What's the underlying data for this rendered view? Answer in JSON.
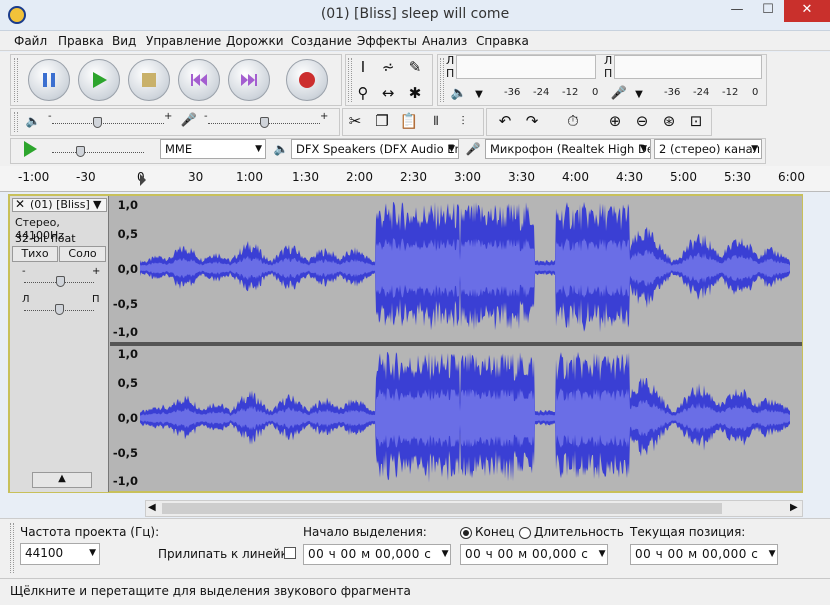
{
  "window": {
    "title": "(01) [Bliss] sleep will come",
    "min": "—",
    "max": "☐",
    "close": "✕"
  },
  "menu": [
    "Файл",
    "Правка",
    "Вид",
    "Управление",
    "Дорожки",
    "Создание",
    "Эффекты",
    "Анализ",
    "Справка"
  ],
  "meters": {
    "left": "Л",
    "right": "П",
    "scale": [
      "-36",
      "-24",
      "-12",
      "0"
    ]
  },
  "device": {
    "host": "MME",
    "output": "DFX Speakers (DFX Audio Enha",
    "input": "Микрофон (Realtek High Defir",
    "channels": "2 (стерео) канал"
  },
  "ruler": [
    "-1:00",
    "-30",
    "0",
    "30",
    "1:00",
    "1:30",
    "2:00",
    "2:30",
    "3:00",
    "3:30",
    "4:00",
    "4:30",
    "5:00",
    "5:30",
    "6:00"
  ],
  "track": {
    "name": "(01) [Bliss]",
    "rate": "Стерео, 44100Hz",
    "format": "32-bit float",
    "mute": "Тихо",
    "solo": "Соло",
    "gain_minus": "-",
    "gain_plus": "+",
    "pan_l": "Л",
    "pan_r": "П"
  },
  "vaxis": [
    "1,0",
    "0,5",
    "0,0",
    "-0,5",
    "-1,0"
  ],
  "waveform_color": "#3a3fd4",
  "selection": {
    "rate_label": "Частота проекта (Гц):",
    "rate": "44100",
    "snap": "Прилипать к линейке",
    "start_label": "Начало выделения:",
    "end_label": "Конец",
    "length_label": "Длительность",
    "pos_label": "Текущая позиция:",
    "start": "00 ч 00 м 00,000 с",
    "end": "00 ч 00 м 00,000 с",
    "pos": "00 ч 00 м 00,000 с"
  },
  "status": "Щёлкните и перетащите для выделения звукового фрагмента"
}
